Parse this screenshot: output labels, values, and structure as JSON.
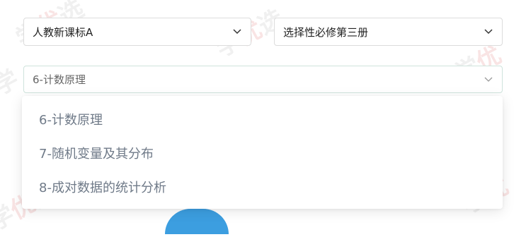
{
  "selects": [
    {
      "value": "人教新课标A"
    },
    {
      "value": "选择性必修第三册"
    },
    {
      "value": "6-计数原理"
    }
  ],
  "dropdown": {
    "options": [
      "6-计数原理",
      "7-随机变量及其分布",
      "8-成对数据的统计分析"
    ]
  },
  "icons": {
    "select_chevron": "chevron-down-icon"
  },
  "colors": {
    "option_text": "#6f7a88",
    "button": "#3c9ee0",
    "border": "#dcdcdc"
  }
}
